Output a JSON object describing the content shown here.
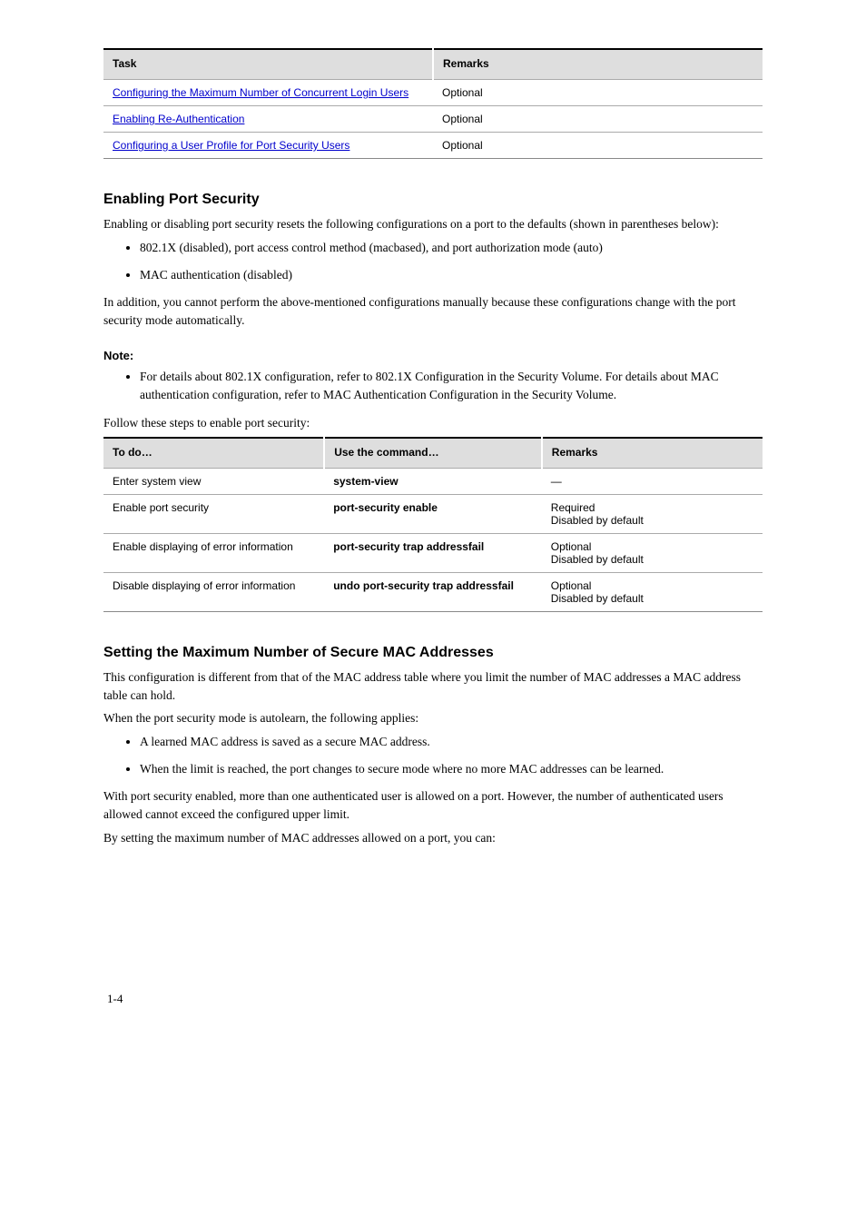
{
  "table1": {
    "headers": [
      "Task",
      "Remarks"
    ],
    "rows": [
      {
        "task_link": "Configuring the Maximum Number of Concurrent Login Users",
        "remarks": "Optional"
      },
      {
        "task_link": "Enabling Re-Authentication",
        "remarks": "Optional"
      },
      {
        "task_link": "Configuring a User Profile for Port Security Users",
        "remarks": "Optional"
      }
    ]
  },
  "section1": {
    "heading": "Enabling Port Security",
    "p1": "Enabling or disabling port security resets the following configurations on a port to the defaults (shown in parentheses below):",
    "bullets": [
      "802.1X (disabled), port access control method (macbased), and port authorization mode (auto)",
      "MAC authentication (disabled)"
    ],
    "p2": "In addition, you cannot perform the above-mentioned configurations manually because these configurations change with the port security mode automatically.",
    "note_label": "Note:",
    "note_bullet": "For details about 802.1X configuration, refer to 802.1X Configuration in the Security Volume. For details about MAC authentication configuration, refer to MAC Authentication Configuration in the Security Volume.",
    "p3": "Follow these steps to enable port security:"
  },
  "table2": {
    "headers": [
      "To do…",
      "Use the command…",
      "Remarks"
    ],
    "rows": [
      [
        "Enter system view",
        "system-view",
        "—"
      ],
      [
        "Enable port security",
        "port-security enable",
        "Required\nDisabled by default"
      ],
      [
        "Enable displaying of error information",
        "port-security trap addressfail",
        "Optional\nDisabled by default"
      ],
      [
        "Disable displaying of error information",
        "undo port-security trap addressfail",
        "Optional\nDisabled by default"
      ]
    ]
  },
  "section2": {
    "heading": "Setting the Maximum Number of Secure MAC Addresses",
    "p1": "This configuration is different from that of the MAC address table where you limit the number of MAC addresses a MAC address table can hold.",
    "p2": "When the port security mode is autolearn, the following applies:",
    "bullets": [
      "A learned MAC address is saved as a secure MAC address.",
      "When the limit is reached, the port changes to secure mode where no more MAC addresses can be learned."
    ],
    "p3": "With port security enabled, more than one authenticated user is allowed on a port. However, the number of authenticated users allowed cannot exceed the configured upper limit.",
    "p4": "By setting the maximum number of MAC addresses allowed on a port, you can:"
  },
  "page_number": "1-4"
}
